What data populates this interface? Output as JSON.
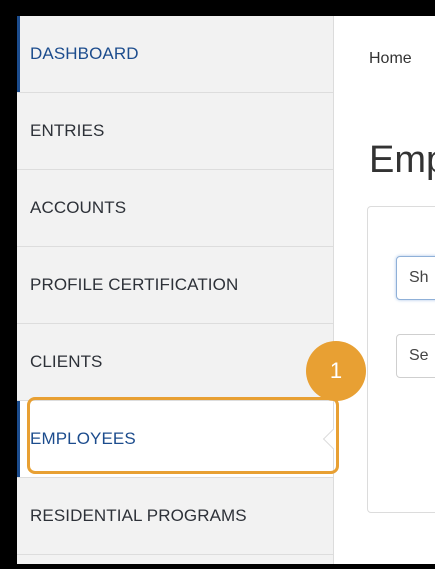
{
  "sidebar": {
    "items": [
      {
        "label": "DASHBOARD"
      },
      {
        "label": "ENTRIES"
      },
      {
        "label": "ACCOUNTS"
      },
      {
        "label": "PROFILE CERTIFICATION"
      },
      {
        "label": "CLIENTS"
      },
      {
        "label": "EMPLOYEES"
      },
      {
        "label": "RESIDENTIAL PROGRAMS"
      }
    ]
  },
  "annotation": {
    "step_number": "1",
    "highlight_color": "#e8a033"
  },
  "main": {
    "breadcrumb": "Home",
    "title": "Emp",
    "controls": {
      "first_visible": "Sh",
      "second_visible": "Se"
    }
  },
  "colors": {
    "accent": "#1c4c8d",
    "sidebar_bg": "#f2f2f2"
  }
}
